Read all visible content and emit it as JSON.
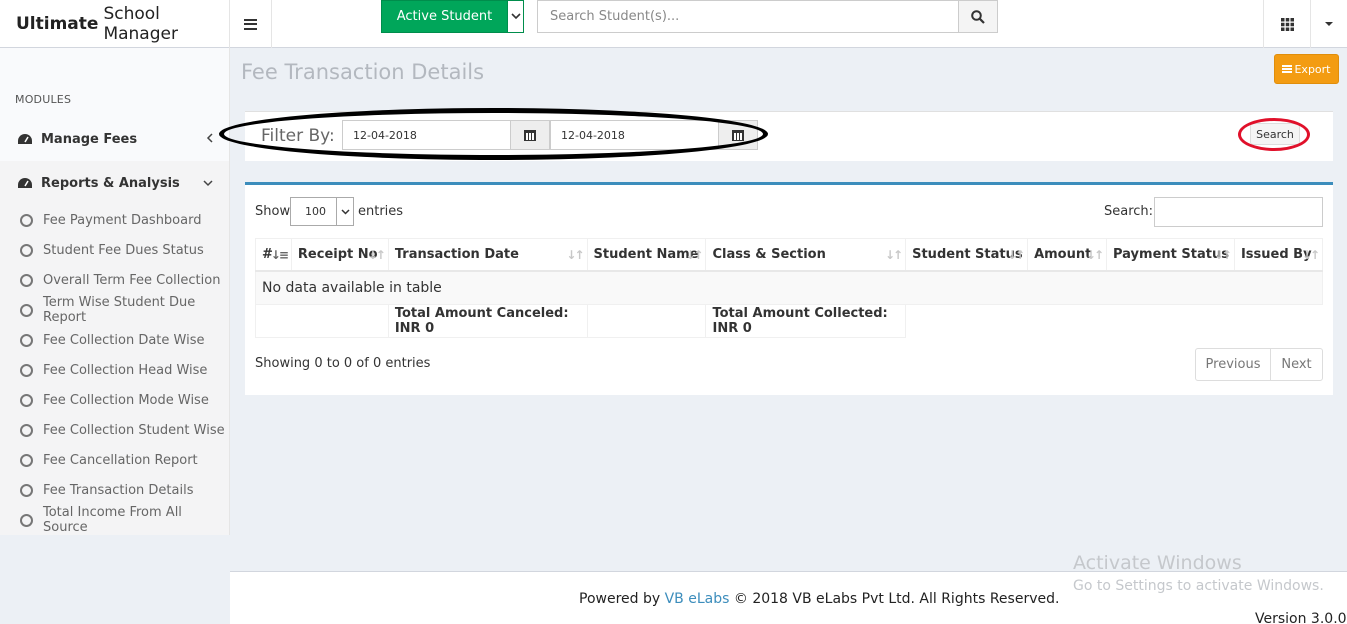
{
  "app": {
    "brand_bold": "Ultimate",
    "brand_rest": "School Manager",
    "active_student_label": "Active Student",
    "search_placeholder": "Search Student(s)..."
  },
  "sidebar": {
    "modules_header": "MODULES",
    "manage_fees": "Manage Fees",
    "reports_analysis": "Reports & Analysis",
    "items": [
      "Fee Payment Dashboard",
      "Student Fee Dues Status",
      "Overall Term Fee Collection",
      "Term Wise Student Due Report",
      "Fee Collection Date Wise",
      "Fee Collection Head Wise",
      "Fee Collection Mode Wise",
      "Fee Collection Student Wise",
      "Fee Cancellation Report",
      "Fee Transaction Details",
      "Total Income From All Source"
    ]
  },
  "page": {
    "title": "Fee Transaction Details",
    "export_label": "Export"
  },
  "filter": {
    "label": "Filter By:",
    "from_date": "12-04-2018",
    "to_date": "12-04-2018",
    "search_label": "Search"
  },
  "table": {
    "show_label": "Show",
    "page_length": "100",
    "entries_label": "entries",
    "search_label": "Search:",
    "columns": [
      "#",
      "Receipt No",
      "Transaction Date",
      "Student Name",
      "Class & Section",
      "Student Status",
      "Amount",
      "Payment Status",
      "Issued By"
    ],
    "empty_text": "No data available in table",
    "total_canceled": "Total Amount Canceled: INR 0",
    "total_collected": "Total Amount Collected: INR 0",
    "info": "Showing 0 to 0 of 0 entries",
    "previous_label": "Previous",
    "next_label": "Next"
  },
  "footer": {
    "powered_by": "Powered by",
    "company_link": "VB eLabs",
    "copyright": "© 2018 VB eLabs Pvt Ltd. All Rights Reserved.",
    "version": "Version 3.0.0"
  },
  "watermark": {
    "line1": "Activate Windows",
    "line2": "Go to Settings to activate Windows."
  },
  "colors": {
    "active_button": "#00a65a",
    "export_button": "#f39c12",
    "table_accent": "#3c8dbc",
    "annotation_red": "#e0102a"
  }
}
